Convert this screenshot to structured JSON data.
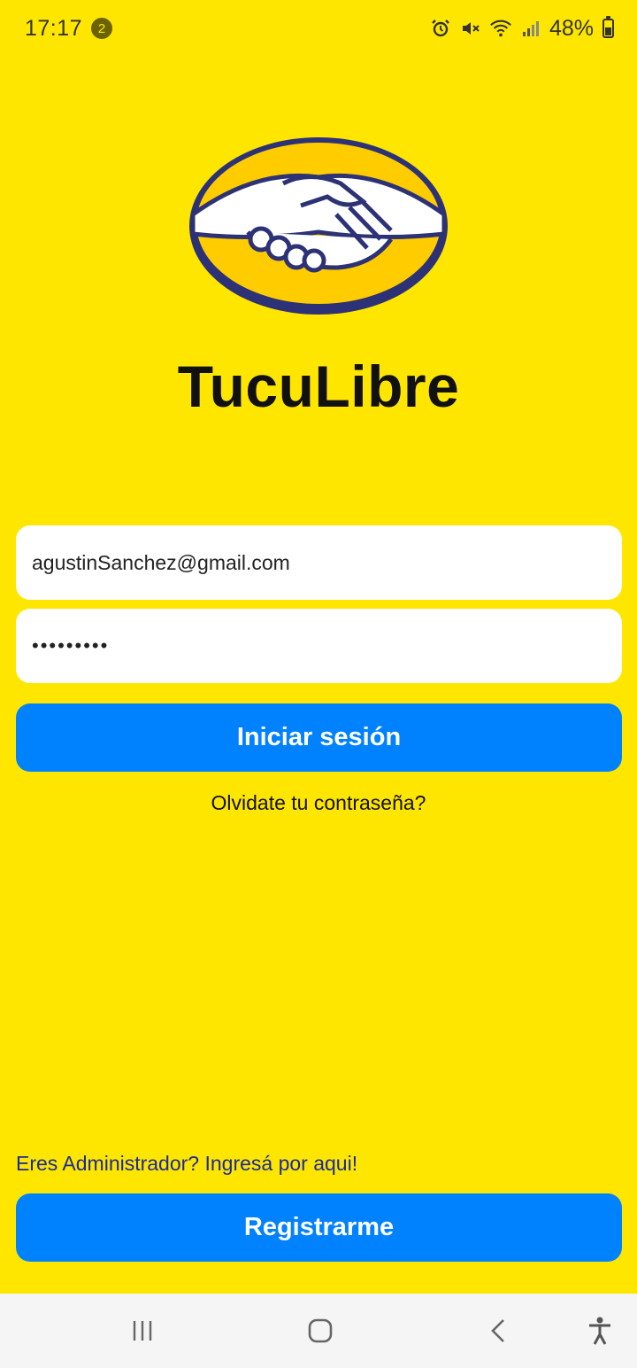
{
  "status_bar": {
    "time": "17:17",
    "notification_count": "2",
    "battery": "48%",
    "icons": [
      "alarm-icon",
      "mute-icon",
      "wifi-icon",
      "signal-icon",
      "battery-icon"
    ]
  },
  "app": {
    "title": "TucuLibre",
    "logo_icon": "handshake-logo"
  },
  "login_form": {
    "email_value": "agustinSanchez@gmail.com",
    "password_value": "•••••••••",
    "login_button": "Iniciar sesión",
    "forgot_password": "Olvidate tu contraseña?"
  },
  "footer": {
    "admin_link": "Eres Administrador? Ingresá por aqui!",
    "register_button": "Registrarme"
  },
  "nav_bar": {
    "icons": [
      "recent-apps-icon",
      "home-icon",
      "back-icon",
      "accessibility-icon"
    ]
  },
  "colors": {
    "background": "#FFE600",
    "button": "#0082FF",
    "link": "#1a2a9a",
    "logo_border": "#2D3277"
  }
}
